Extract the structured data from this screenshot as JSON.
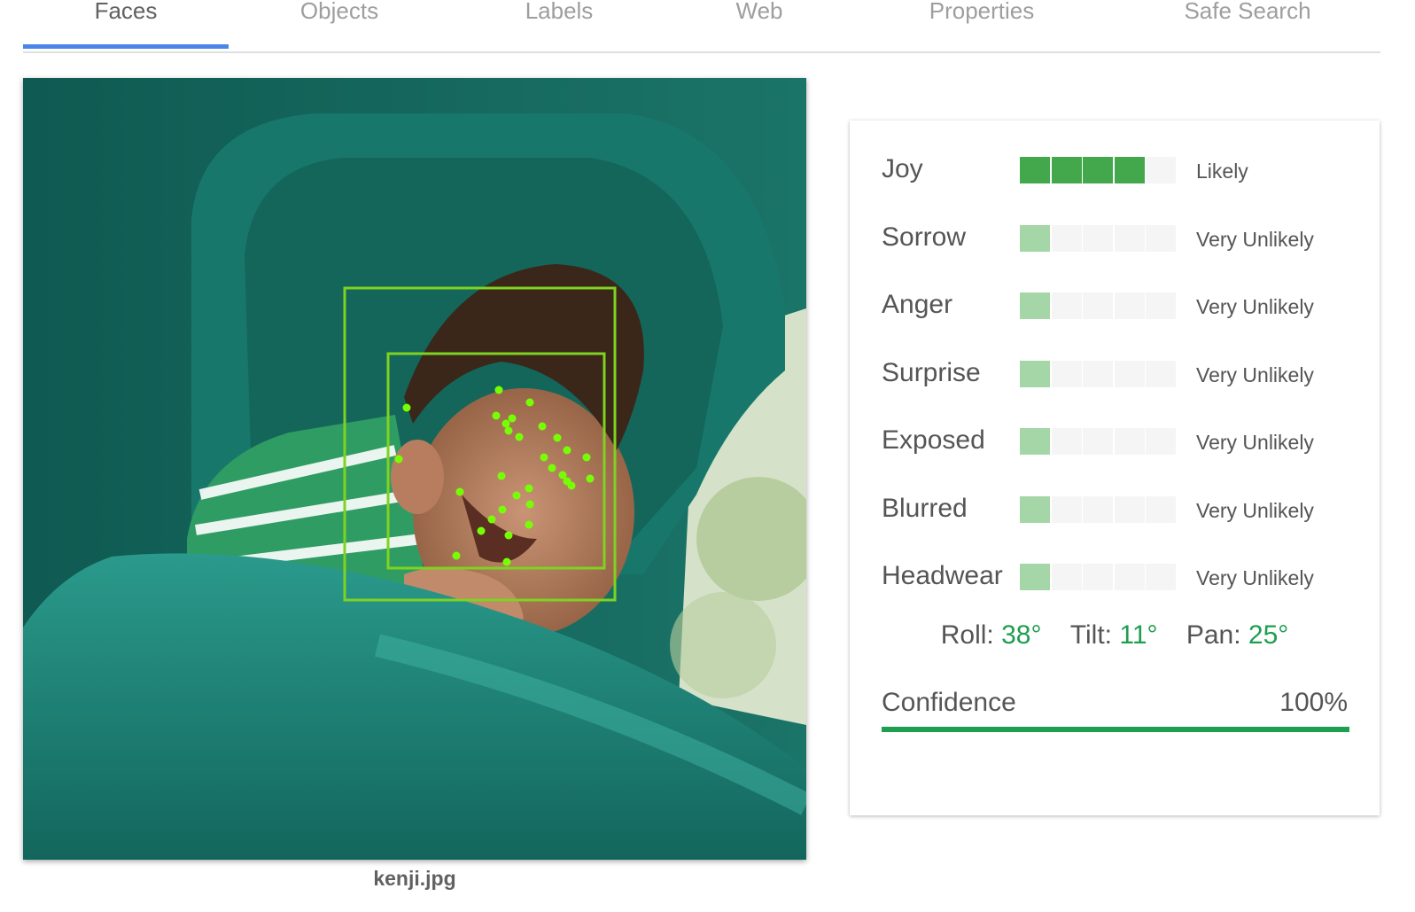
{
  "tabs": [
    {
      "label": "Faces",
      "active": true
    },
    {
      "label": "Objects",
      "active": false
    },
    {
      "label": "Labels",
      "active": false
    },
    {
      "label": "Web",
      "active": false
    },
    {
      "label": "Properties",
      "active": false
    },
    {
      "label": "Safe Search",
      "active": false
    }
  ],
  "image": {
    "filename": "kenji.jpg"
  },
  "attributes": [
    {
      "label": "Joy",
      "value": "Likely",
      "level": 4
    },
    {
      "label": "Sorrow",
      "value": "Very Unlikely",
      "level": 1
    },
    {
      "label": "Anger",
      "value": "Very Unlikely",
      "level": 1
    },
    {
      "label": "Surprise",
      "value": "Very Unlikely",
      "level": 1
    },
    {
      "label": "Exposed",
      "value": "Very Unlikely",
      "level": 1
    },
    {
      "label": "Blurred",
      "value": "Very Unlikely",
      "level": 1
    },
    {
      "label": "Headwear",
      "value": "Very Unlikely",
      "level": 1
    }
  ],
  "meter_max": 5,
  "angles": {
    "roll_label": "Roll:",
    "roll": "38°",
    "tilt_label": "Tilt:",
    "tilt": "11°",
    "pan_label": "Pan:",
    "pan": "25°"
  },
  "confidence": {
    "label": "Confidence",
    "value": "100%",
    "fraction": 1.0
  },
  "colors": {
    "accent_tab": "#4a86e8",
    "meter_strong": "#43a84b",
    "meter_weak": "#a5d6a7",
    "meter_empty": "#f5f5f5",
    "angle_value": "#1e9e4f",
    "face_box": "#7ed321",
    "landmark": "#76ff03"
  }
}
